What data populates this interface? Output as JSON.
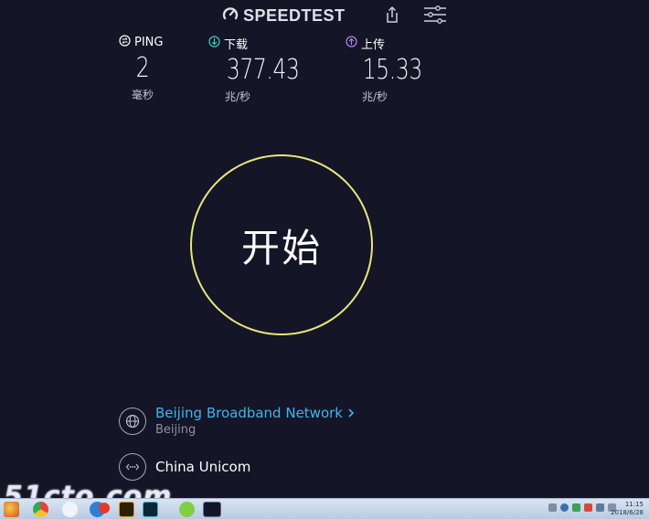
{
  "header": {
    "logo_text": "SPEEDTEST",
    "icons": [
      "speedometer-logo-icon",
      "share-icon",
      "settings-sliders-icon"
    ]
  },
  "metrics": {
    "ping": {
      "label": "PING",
      "value": "2",
      "unit": "毫秒",
      "icon": "ping-icon"
    },
    "download": {
      "label": "下载",
      "value": "377.43",
      "unit": "兆/秒",
      "icon": "download-arrow-icon",
      "color": "#3dd3c6"
    },
    "upload": {
      "label": "上传",
      "value": "15.33",
      "unit": "兆/秒",
      "icon": "upload-arrow-icon",
      "color": "#b585e6"
    }
  },
  "go_button": {
    "label": "开始",
    "ring_color": "#e9e57e"
  },
  "isp": {
    "name": "Beijing Broadband Network",
    "location": "Beijing",
    "icon": "globe-icon",
    "color": "#3db6ee"
  },
  "server": {
    "name": "China Unicom",
    "icon": "server-dots-icon"
  },
  "watermark": {
    "text": "51cto.com"
  },
  "taskbar": {
    "clock_time": "11:15",
    "clock_date": "2018/6/28",
    "items": [
      "start-button",
      "chrome-icon",
      "qq-icon",
      "browser-icon",
      "app-red-icon",
      "photoshop-icon",
      "dreamweaver-icon",
      "wechat-icon",
      "speedtest-taskbar-icon"
    ]
  }
}
